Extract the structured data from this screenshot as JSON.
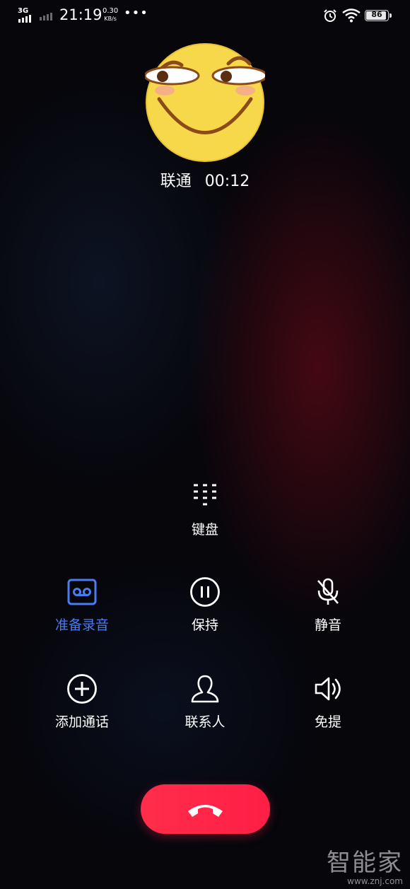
{
  "status_bar": {
    "network": "3G",
    "time": "21:19",
    "speed_value": "0.30",
    "speed_unit": "KB/s",
    "more": "•••",
    "battery": "86"
  },
  "caller": {
    "name": "联通",
    "duration": "00:12"
  },
  "controls": {
    "keypad": "键盘",
    "record": "准备录音",
    "hold": "保持",
    "mute": "静音",
    "add_call": "添加通话",
    "contacts": "联系人",
    "speaker": "免提"
  },
  "colors": {
    "accent_blue": "#4a7cf0",
    "end_call_red": "#ff2d4a"
  },
  "watermark": {
    "brand": "智能家",
    "url": "www.znj.com"
  }
}
